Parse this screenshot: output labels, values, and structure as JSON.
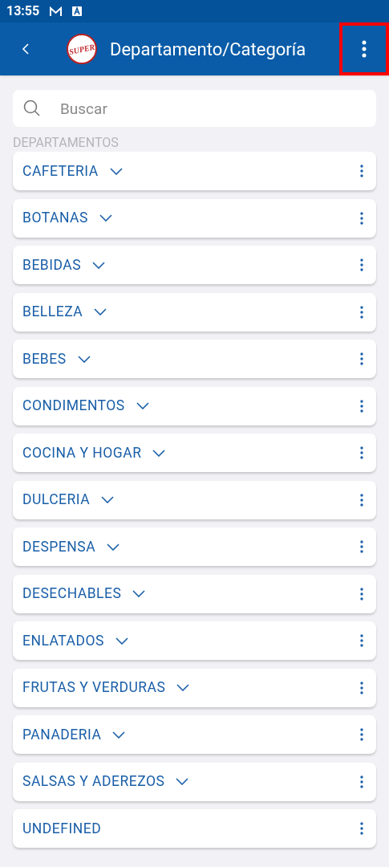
{
  "status_bar": {
    "time": "13:55"
  },
  "app_bar": {
    "logo_text": "SUPER",
    "title": "Departamento/Categoría",
    "menu_highlighted": true
  },
  "search": {
    "placeholder": "Buscar"
  },
  "section_label": "DEPARTAMENTOS",
  "departments": [
    {
      "name": "CAFETERIA",
      "expandable": true
    },
    {
      "name": "BOTANAS",
      "expandable": true
    },
    {
      "name": "BEBIDAS",
      "expandable": true
    },
    {
      "name": "BELLEZA",
      "expandable": true
    },
    {
      "name": "BEBES",
      "expandable": true
    },
    {
      "name": "CONDIMENTOS",
      "expandable": true
    },
    {
      "name": "COCINA Y HOGAR",
      "expandable": true
    },
    {
      "name": "DULCERIA",
      "expandable": true
    },
    {
      "name": "DESPENSA",
      "expandable": true
    },
    {
      "name": "DESECHABLES",
      "expandable": true
    },
    {
      "name": "ENLATADOS",
      "expandable": true
    },
    {
      "name": "FRUTAS Y VERDURAS",
      "expandable": true
    },
    {
      "name": "PANADERIA",
      "expandable": true
    },
    {
      "name": "SALSAS Y ADEREZOS",
      "expandable": true
    },
    {
      "name": "UNDEFINED",
      "expandable": false
    }
  ]
}
